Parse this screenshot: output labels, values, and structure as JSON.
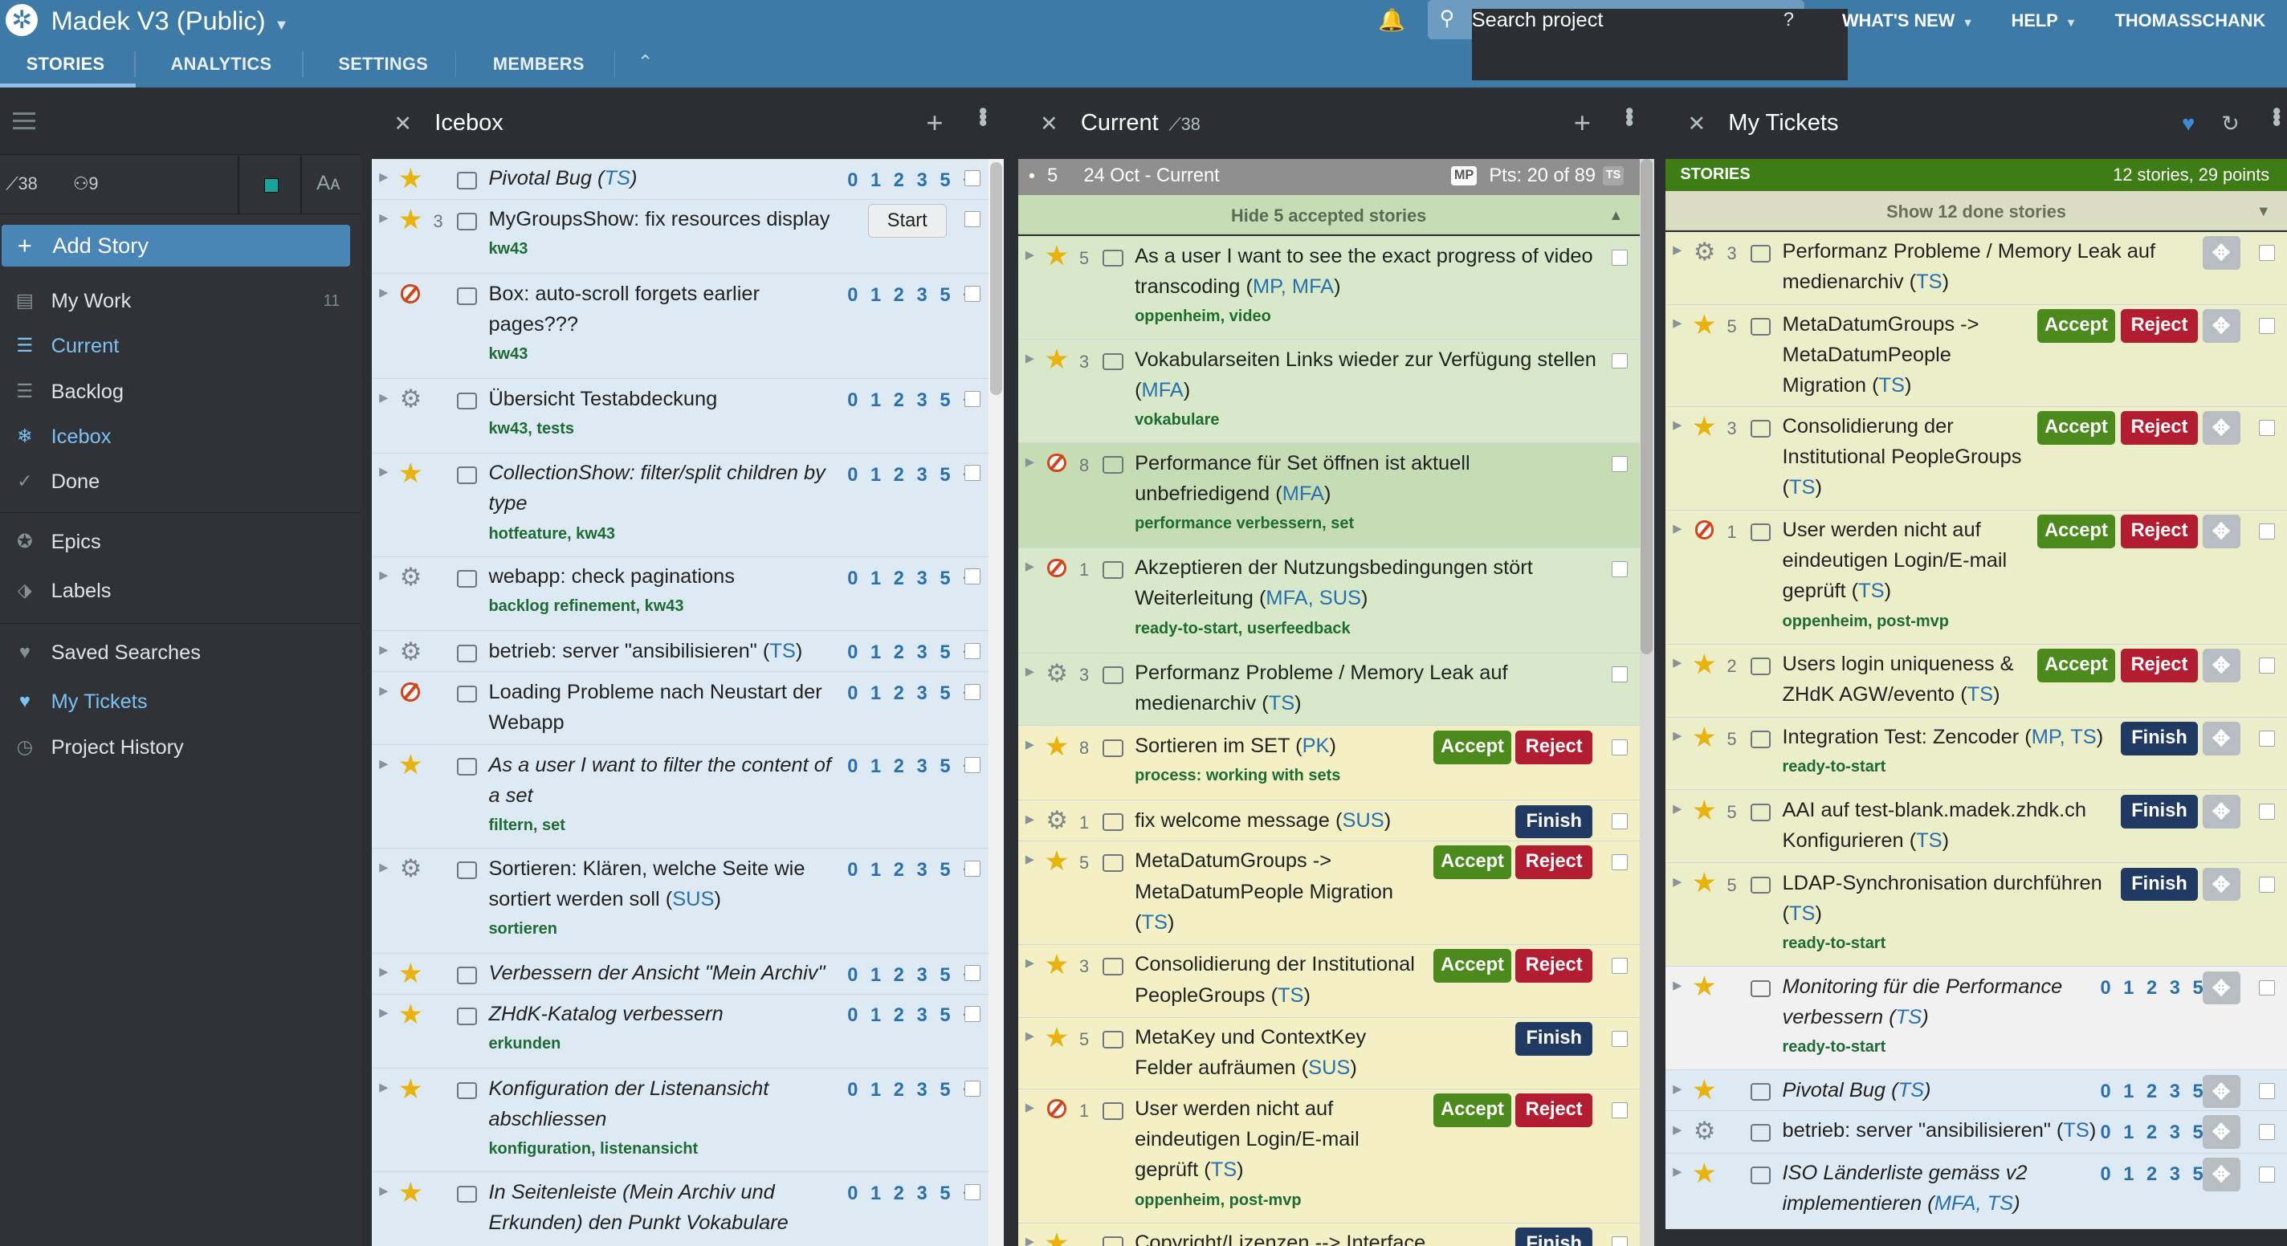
{
  "app": {
    "project_name": "Madek V3 (Public)",
    "search_placeholder": "Search project",
    "search_help": "?",
    "whats_new": "WHAT'S NEW",
    "help": "HELP",
    "user": "THOMASSCHANK"
  },
  "tabs": [
    "STORIES",
    "ANALYTICS",
    "SETTINGS",
    "MEMBERS"
  ],
  "sidebar": {
    "velocity": "38",
    "members": "9",
    "font_toggle": "Aᴀ",
    "add_story": "Add Story",
    "items": [
      {
        "label": "My Work",
        "count": "11"
      },
      {
        "label": "Current"
      },
      {
        "label": "Backlog"
      },
      {
        "label": "Icebox"
      },
      {
        "label": "Done"
      },
      {
        "label": "Epics"
      },
      {
        "label": "Labels"
      },
      {
        "label": "Saved Searches"
      },
      {
        "label": "My Tickets"
      },
      {
        "label": "Project History"
      }
    ]
  },
  "icebox": {
    "title": "Icebox",
    "points_scale": "0 1 2 3 5 +",
    "stories": [
      {
        "type": "feature",
        "name": "Pivotal Bug",
        "owners": "TS",
        "italic": true
      },
      {
        "type": "feature",
        "estimate": "3",
        "name": "MyGroupsShow: fix resources display",
        "labels": "kw43",
        "button": "Start"
      },
      {
        "type": "bug",
        "name": "Box: auto-scroll forgets earlier pages???",
        "labels": "kw43"
      },
      {
        "type": "chore",
        "name": "Übersicht Testabdeckung",
        "labels": "kw43, tests"
      },
      {
        "type": "feature",
        "name": "CollectionShow: filter/split children by type",
        "labels": "hotfeature, kw43",
        "italic": true
      },
      {
        "type": "chore",
        "name": "webapp: check paginations",
        "labels": "backlog refinement, kw43"
      },
      {
        "type": "chore",
        "name": "betrieb: server \"ansibilisieren\"",
        "owners": "TS"
      },
      {
        "type": "bug",
        "name": "Loading Probleme nach Neustart der Webapp"
      },
      {
        "type": "feature",
        "name": "As a user I want to filter the content of a set",
        "labels": "filtern, set",
        "italic": true
      },
      {
        "type": "chore",
        "name": "Sortieren: Klären, welche Seite wie sortiert werden soll",
        "owners": "SUS",
        "labels": "sortieren"
      },
      {
        "type": "feature",
        "name": "Verbessern der Ansicht \"Mein Archiv\"",
        "italic": true
      },
      {
        "type": "feature",
        "name": "ZHdK-Katalog verbessern",
        "labels": "erkunden",
        "italic": true
      },
      {
        "type": "feature",
        "name": "Konfiguration der Listenansicht abschliessen",
        "labels": "konfiguration, listenansicht",
        "italic": true
      },
      {
        "type": "feature",
        "name": "In Seitenleiste (Mein Archiv und Erkunden) den Punkt Vokabulare",
        "italic": true
      }
    ]
  },
  "current": {
    "title": "Current",
    "velocity": "38",
    "iteration": {
      "number": "5",
      "label": "24 Oct - Current",
      "badge_mp": "MP",
      "points": "Pts: 20 of 89",
      "badge_ts": "TS"
    },
    "hide_accepted": "Hide 5 accepted stories",
    "stories": [
      {
        "type": "feature",
        "estimate": "5",
        "name": "As a user I want to see the exact progress of video transcoding",
        "owners": "MP, MFA",
        "labels": "oppenheim, video"
      },
      {
        "type": "feature",
        "estimate": "3",
        "name": "Vokabularseiten Links wieder zur Verfügung stellen",
        "owners": "MFA",
        "labels": "vokabulare"
      },
      {
        "type": "bug",
        "estimate": "8",
        "name": "Performance für Set öffnen ist aktuell unbefriedigend",
        "owners": "MFA",
        "labels": "performance verbessern, set"
      },
      {
        "type": "bug",
        "estimate": "1",
        "name": "Akzeptieren der Nutzungsbedingungen stört Weiterleitung",
        "owners": "MFA, SUS",
        "labels": "ready-to-start, userfeedback"
      },
      {
        "type": "chore",
        "estimate": "3",
        "name": "Performanz Probleme / Memory Leak auf medienarchiv",
        "owners": "TS"
      },
      {
        "type": "feature",
        "estimate": "8",
        "name": "Sortieren im SET",
        "owners": "PK",
        "labels": "process: working with sets"
      },
      {
        "type": "chore",
        "estimate": "1",
        "name": "fix welcome message",
        "owners": "SUS"
      },
      {
        "type": "feature",
        "estimate": "5",
        "name": "MetaDatumGroups -> MetaDatumPeople Migration",
        "owners": "TS"
      },
      {
        "type": "feature",
        "estimate": "3",
        "name": "Consolidierung der Institutional PeopleGroups",
        "owners": "TS"
      },
      {
        "type": "feature",
        "estimate": "5",
        "name": "MetaKey und ContextKey Felder aufräumen",
        "owners": "SUS"
      },
      {
        "type": "bug",
        "estimate": "1",
        "name": "User werden nicht auf eindeutigen Login/E-mail geprüft",
        "owners": "TS",
        "labels": "oppenheim, post-mvp"
      },
      {
        "type": "feature",
        "name": "Copyright/Lizenzen --> Interface"
      }
    ],
    "buttons": {
      "accept": "Accept",
      "reject": "Reject",
      "finish": "Finish"
    }
  },
  "mytickets": {
    "title": "My Tickets",
    "header_label": "STORIES",
    "header_count": "12 stories, 29 points",
    "show_done": "Show 12 done stories",
    "stories": [
      {
        "type": "chore",
        "estimate": "3",
        "name": "Performanz Probleme / Memory Leak auf medienarchiv",
        "owners": "TS"
      },
      {
        "type": "feature",
        "estimate": "5",
        "name": "MetaDatumGroups -> MetaDatumPeople Migration",
        "owners": "TS"
      },
      {
        "type": "feature",
        "estimate": "3",
        "name": "Consolidierung der Institutional PeopleGroups",
        "owners": "TS"
      },
      {
        "type": "bug",
        "estimate": "1",
        "name": "User werden nicht auf eindeutigen Login/E-mail geprüft",
        "owners": "TS",
        "labels": "oppenheim, post-mvp"
      },
      {
        "type": "feature",
        "estimate": "2",
        "name": "Users login uniqueness & ZHdK AGW/evento",
        "owners": "TS"
      },
      {
        "type": "feature",
        "estimate": "5",
        "name": "Integration Test: Zencoder",
        "owners": "MP, TS",
        "labels": "ready-to-start"
      },
      {
        "type": "feature",
        "estimate": "5",
        "name": "AAI auf test-blank.madek.zhdk.ch Konfigurieren",
        "owners": "TS"
      },
      {
        "type": "feature",
        "estimate": "5",
        "name": "LDAP-Synchronisation durchführen",
        "owners": "TS",
        "labels": "ready-to-start"
      },
      {
        "type": "feature",
        "name": "Monitoring für die Performance verbessern",
        "owners": "TS",
        "labels": "ready-to-start",
        "italic": true
      },
      {
        "type": "feature",
        "name": "Pivotal Bug",
        "owners": "TS",
        "italic": true
      },
      {
        "type": "chore",
        "name": "betrieb: server \"ansibilisieren\"",
        "owners": "TS"
      },
      {
        "type": "feature",
        "name": "ISO Länderliste gemäss v2 implementieren",
        "owners": "MFA, TS",
        "italic": true
      }
    ]
  }
}
